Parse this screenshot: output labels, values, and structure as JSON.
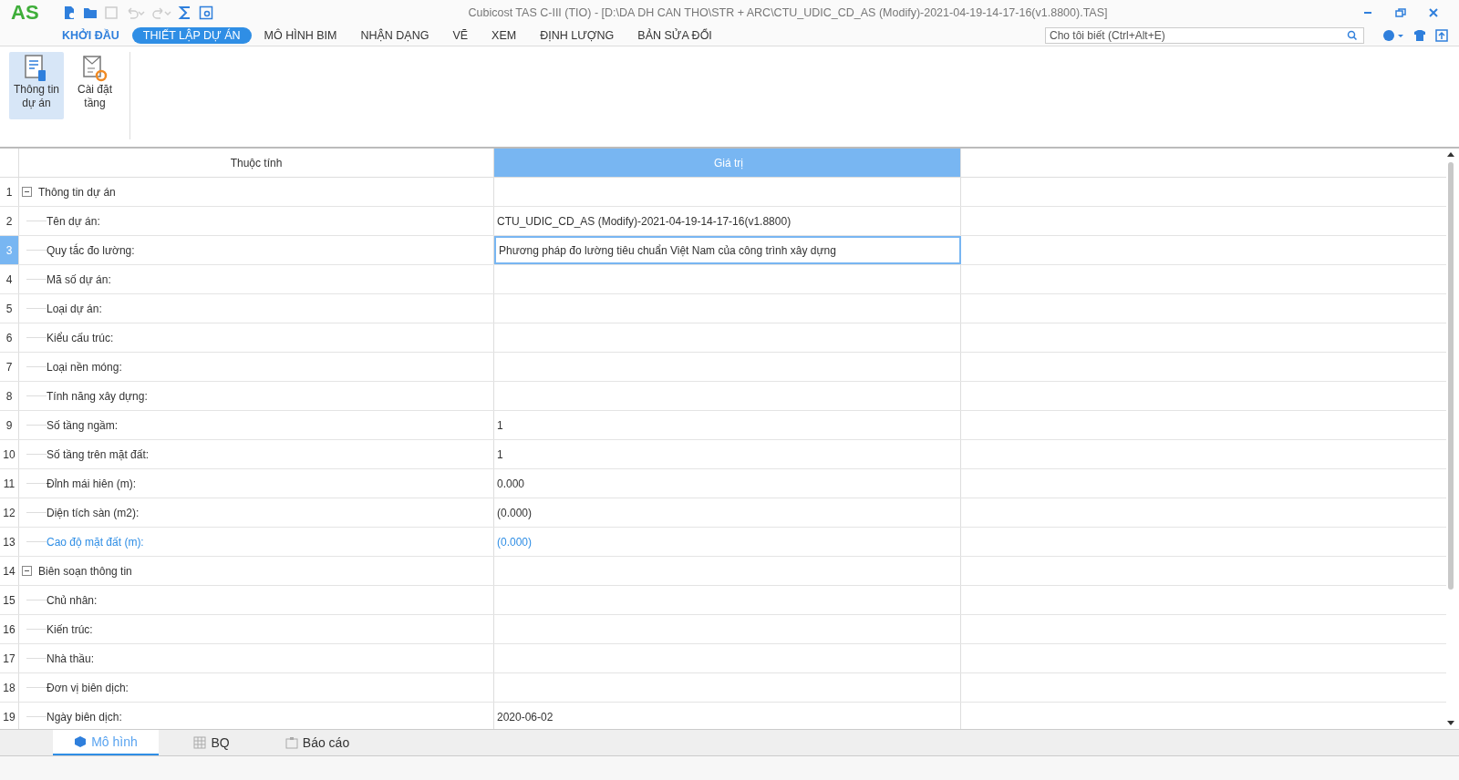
{
  "window": {
    "title": "Cubicost TAS C-III (TIO) - [D:\\DA DH CAN THO\\STR + ARC\\CTU_UDIC_CD_AS (Modify)-2021-04-19-14-17-16(v1.8800).TAS]",
    "logo": "AS"
  },
  "menu": [
    {
      "label": "KHỞI ĐẦU",
      "selected": false
    },
    {
      "label": "THIẾT LẬP DỰ ÁN",
      "selected": true
    },
    {
      "label": "MÔ HÌNH BIM",
      "selected": false
    },
    {
      "label": "NHẬN DẠNG",
      "selected": false
    },
    {
      "label": "VẼ",
      "selected": false
    },
    {
      "label": "XEM",
      "selected": false
    },
    {
      "label": "ĐỊNH LƯỢNG",
      "selected": false
    },
    {
      "label": "BẢN SỬA ĐỔI",
      "selected": false
    }
  ],
  "search": {
    "placeholder": "Cho tôi biết (Ctrl+Alt+E)"
  },
  "ribbon": [
    {
      "label": "Thông tin dự án",
      "selected": true
    },
    {
      "label": "Cài đặt tầng",
      "selected": false
    }
  ],
  "table": {
    "columns": [
      "Thuộc tính",
      "Giá trị"
    ],
    "groups": [
      {
        "num": "1",
        "label": "Thông tin dự án",
        "expanded": true,
        "children": [
          {
            "num": "2",
            "label": "Tên dự án:",
            "value": "CTU_UDIC_CD_AS (Modify)-2021-04-19-14-17-16(v1.8800)",
            "selected": false,
            "highlighted": false
          },
          {
            "num": "3",
            "label": "Quy tắc đo lường:",
            "value": "Phương pháp đo lường tiêu chuẩn Việt Nam của công trình xây dựng",
            "selected": true,
            "highlighted": false
          },
          {
            "num": "4",
            "label": "Mã số dự án:",
            "selected": false,
            "highlighted": false
          },
          {
            "num": "5",
            "label": "Loại dự án:",
            "selected": false,
            "highlighted": false
          },
          {
            "num": "6",
            "label": "Kiểu cấu trúc:",
            "selected": false,
            "highlighted": false
          },
          {
            "num": "7",
            "label": "Loại nền móng:",
            "selected": false,
            "highlighted": false
          },
          {
            "num": "8",
            "label": "Tính năng xây dựng:",
            "selected": false,
            "highlighted": false
          },
          {
            "num": "9",
            "label": "Số tầng ngầm:",
            "value": "1",
            "selected": false,
            "highlighted": false
          },
          {
            "num": "10",
            "label": "Số tầng trên mặt đất:",
            "value": "1",
            "selected": false,
            "highlighted": false
          },
          {
            "num": "11",
            "label": "Đỉnh mái hiên (m):",
            "value": "0.000",
            "selected": false,
            "highlighted": false
          },
          {
            "num": "12",
            "label": "Diện tích sàn (m2):",
            "value": "(0.000)",
            "selected": false,
            "highlighted": false
          },
          {
            "num": "13",
            "label": "Cao độ mặt đất (m):",
            "value": "(0.000)",
            "selected": false,
            "highlighted": true
          }
        ]
      },
      {
        "num": "14",
        "label": "Biên soạn thông tin",
        "expanded": true,
        "children": [
          {
            "num": "15",
            "label": "Chủ nhân:",
            "selected": false,
            "highlighted": false
          },
          {
            "num": "16",
            "label": "Kiến trúc:",
            "selected": false,
            "highlighted": false
          },
          {
            "num": "17",
            "label": "Nhà thầu:",
            "selected": false,
            "highlighted": false
          },
          {
            "num": "18",
            "label": "Đơn vị biên dịch:",
            "selected": false,
            "highlighted": false
          },
          {
            "num": "19",
            "label": "Ngày biên dịch:",
            "value": "2020-06-02",
            "selected": false,
            "highlighted": false
          }
        ]
      }
    ]
  },
  "bottom_tabs": [
    {
      "label": "Mô hình",
      "selected": true
    },
    {
      "label": "BQ",
      "selected": false
    },
    {
      "label": "Báo cáo",
      "selected": false
    }
  ]
}
